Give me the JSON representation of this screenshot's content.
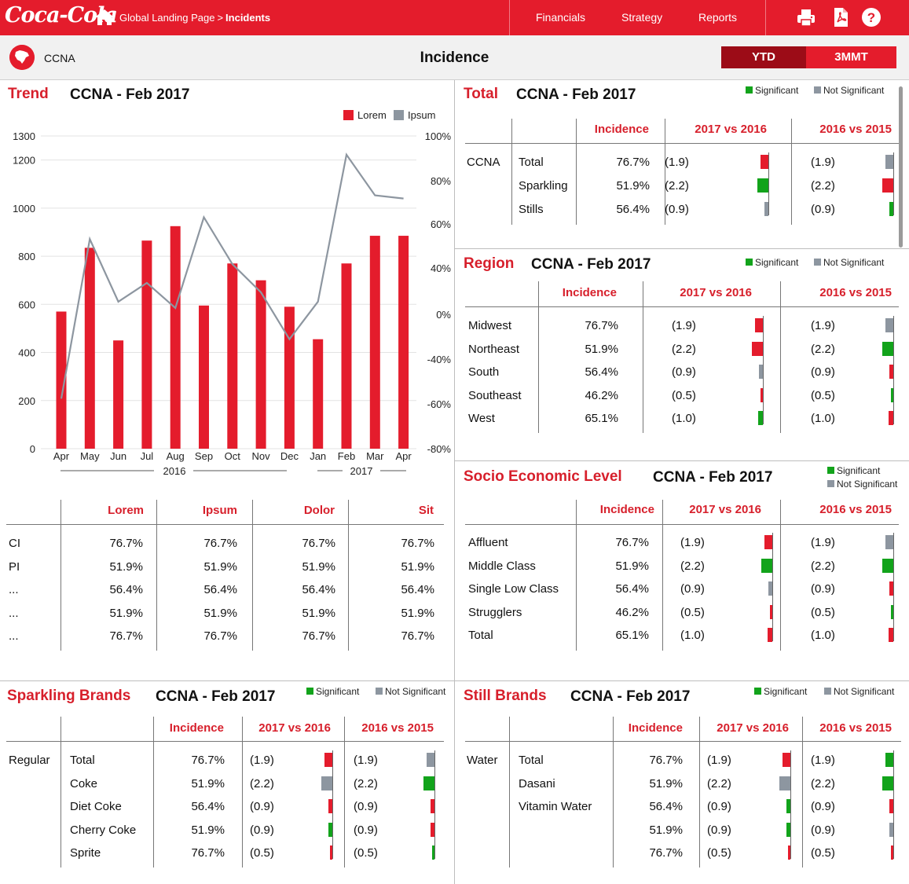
{
  "brand": {
    "logo_text": "Coca-Cola",
    "red": "#e41c2c",
    "dark_red": "#9c0c17",
    "green": "#12a31b",
    "grey": "#8d96a0"
  },
  "header": {
    "breadcrumb_home": "Global Landing Page",
    "breadcrumb_sep": ">",
    "breadcrumb_current": "Incidents",
    "nav": [
      "Financials",
      "Strategy",
      "Reports"
    ],
    "icons": [
      "print-icon",
      "pdf-icon",
      "help-icon"
    ]
  },
  "subheader": {
    "region": "CCNA",
    "title": "Incidence",
    "toggle": [
      "YTD",
      "3MMT"
    ],
    "toggle_active": "YTD"
  },
  "legend": {
    "significant": "Significant",
    "not_significant": "Not Significant"
  },
  "trend": {
    "title": "Trend",
    "subtitle": "CCNA - Feb 2017",
    "chart_data": {
      "type": "bar",
      "categories": [
        "Apr",
        "May",
        "Jun",
        "Jul",
        "Aug",
        "Sep",
        "Oct",
        "Nov",
        "Dec",
        "Jan",
        "Feb",
        "Mar",
        "Apr"
      ],
      "series": [
        {
          "name": "Lorem",
          "type": "bar",
          "axis": "left",
          "color": "#e41c2c",
          "values": [
            570,
            835,
            450,
            865,
            925,
            595,
            770,
            700,
            590,
            455,
            770,
            885,
            885
          ]
        },
        {
          "name": "Ipsum",
          "type": "line",
          "axis": "right",
          "color": "#8d96a0",
          "values": [
            16,
            67,
            47,
            53,
            45,
            74,
            59,
            50,
            35,
            47,
            94,
            81,
            80
          ]
        }
      ],
      "ylim_left": [
        0,
        1300
      ],
      "yticks_left": [
        "1300",
        "1200",
        "1000",
        "800",
        "600",
        "400",
        "200",
        "0"
      ],
      "yticks_left_values": [
        1300,
        1200,
        1000,
        800,
        600,
        400,
        200,
        0
      ],
      "yticks_right": [
        "100%",
        "80%",
        "60%",
        "40%",
        "0%",
        "-40%",
        "-60%",
        "-80%"
      ],
      "year_groups": [
        "2016",
        "2017"
      ]
    },
    "table": {
      "headers": [
        "Lorem",
        "Ipsum",
        "Dolor",
        "Sit"
      ],
      "rows": [
        {
          "label": "CI",
          "values": [
            "76.7%",
            "76.7%",
            "76.7%",
            "76.7%"
          ]
        },
        {
          "label": "PI",
          "values": [
            "51.9%",
            "51.9%",
            "51.9%",
            "51.9%"
          ]
        },
        {
          "label": "...",
          "values": [
            "56.4%",
            "56.4%",
            "56.4%",
            "56.4%"
          ]
        },
        {
          "label": "...",
          "values": [
            "51.9%",
            "51.9%",
            "51.9%",
            "51.9%"
          ]
        },
        {
          "label": "...",
          "values": [
            "76.7%",
            "76.7%",
            "76.7%",
            "76.7%"
          ]
        }
      ]
    }
  },
  "total": {
    "title": "Total",
    "subtitle": "CCNA - Feb 2017",
    "headers": [
      "Incidence",
      "2017 vs 2016",
      "2016 vs 2015"
    ],
    "group": "CCNA",
    "rows": [
      {
        "label": "Total",
        "incidence": "76.7%",
        "v1": "(1.9)",
        "b1": {
          "c": "red",
          "w": 10
        },
        "v2": "(1.9)",
        "b2": {
          "c": "grey",
          "w": 10
        }
      },
      {
        "label": "Sparkling",
        "incidence": "51.9%",
        "v1": "(2.2)",
        "b1": {
          "c": "green",
          "w": 14
        },
        "v2": "(2.2)",
        "b2": {
          "c": "red",
          "w": 14
        }
      },
      {
        "label": "Stills",
        "incidence": "56.4%",
        "v1": "(0.9)",
        "b1": {
          "c": "grey",
          "w": 5
        },
        "v2": "(0.9)",
        "b2": {
          "c": "green",
          "w": 5
        }
      }
    ]
  },
  "region": {
    "title": "Region",
    "subtitle": "CCNA - Feb 2017",
    "headers": [
      "Incidence",
      "2017 vs 2016",
      "2016 vs 2015"
    ],
    "rows": [
      {
        "label": "Midwest",
        "incidence": "76.7%",
        "v1": "(1.9)",
        "b1": {
          "c": "red",
          "w": 10
        },
        "v2": "(1.9)",
        "b2": {
          "c": "grey",
          "w": 10
        }
      },
      {
        "label": "Northeast",
        "incidence": "51.9%",
        "v1": "(2.2)",
        "b1": {
          "c": "red",
          "w": 14
        },
        "v2": "(2.2)",
        "b2": {
          "c": "green",
          "w": 14
        }
      },
      {
        "label": "South",
        "incidence": "56.4%",
        "v1": "(0.9)",
        "b1": {
          "c": "grey",
          "w": 5
        },
        "v2": "(0.9)",
        "b2": {
          "c": "red",
          "w": 5
        }
      },
      {
        "label": "Southeast",
        "incidence": "46.2%",
        "v1": "(0.5)",
        "b1": {
          "c": "red",
          "w": 3
        },
        "v2": "(0.5)",
        "b2": {
          "c": "green",
          "w": 3
        }
      },
      {
        "label": "West",
        "incidence": "65.1%",
        "v1": "(1.0)",
        "b1": {
          "c": "green",
          "w": 6
        },
        "v2": "(1.0)",
        "b2": {
          "c": "red",
          "w": 6
        }
      }
    ]
  },
  "sel": {
    "title": "Socio Economic Level",
    "subtitle": "CCNA - Feb 2017",
    "headers": [
      "Incidence",
      "2017 vs 2016",
      "2016 vs 2015"
    ],
    "rows": [
      {
        "label": "Affluent",
        "incidence": "76.7%",
        "v1": "(1.9)",
        "b1": {
          "c": "red",
          "w": 10
        },
        "v2": "(1.9)",
        "b2": {
          "c": "grey",
          "w": 10
        }
      },
      {
        "label": "Middle Class",
        "incidence": "51.9%",
        "v1": "(2.2)",
        "b1": {
          "c": "green",
          "w": 14
        },
        "v2": "(2.2)",
        "b2": {
          "c": "green",
          "w": 14
        }
      },
      {
        "label": "Single Low Class",
        "incidence": "56.4%",
        "v1": "(0.9)",
        "b1": {
          "c": "grey",
          "w": 5
        },
        "v2": "(0.9)",
        "b2": {
          "c": "red",
          "w": 5
        }
      },
      {
        "label": "Strugglers",
        "incidence": "46.2%",
        "v1": "(0.5)",
        "b1": {
          "c": "red",
          "w": 3
        },
        "v2": "(0.5)",
        "b2": {
          "c": "green",
          "w": 3
        }
      },
      {
        "label": "Total",
        "incidence": "65.1%",
        "v1": "(1.0)",
        "b1": {
          "c": "red",
          "w": 6
        },
        "v2": "(1.0)",
        "b2": {
          "c": "red",
          "w": 6
        }
      }
    ]
  },
  "sparkling": {
    "title": "Sparkling Brands",
    "subtitle": "CCNA - Feb 2017",
    "headers": [
      "Incidence",
      "2017 vs 2016",
      "2016 vs 2015"
    ],
    "group": "Regular",
    "rows": [
      {
        "label": "Total",
        "incidence": "76.7%",
        "v1": "(1.9)",
        "b1": {
          "c": "red",
          "w": 10
        },
        "v2": "(1.9)",
        "b2": {
          "c": "grey",
          "w": 10
        }
      },
      {
        "label": "Coke",
        "incidence": "51.9%",
        "v1": "(2.2)",
        "b1": {
          "c": "grey",
          "w": 14
        },
        "v2": "(2.2)",
        "b2": {
          "c": "green",
          "w": 14
        }
      },
      {
        "label": "Diet Coke",
        "incidence": "56.4%",
        "v1": "(0.9)",
        "b1": {
          "c": "red",
          "w": 5
        },
        "v2": "(0.9)",
        "b2": {
          "c": "red",
          "w": 5
        }
      },
      {
        "label": "Cherry Coke",
        "incidence": "51.9%",
        "v1": "(0.9)",
        "b1": {
          "c": "green",
          "w": 5
        },
        "v2": "(0.9)",
        "b2": {
          "c": "red",
          "w": 5
        }
      },
      {
        "label": "Sprite",
        "incidence": "76.7%",
        "v1": "(0.5)",
        "b1": {
          "c": "red",
          "w": 3
        },
        "v2": "(0.5)",
        "b2": {
          "c": "green",
          "w": 3
        }
      }
    ]
  },
  "still": {
    "title": "Still Brands",
    "subtitle": "CCNA - Feb 2017",
    "headers": [
      "Incidence",
      "2017 vs 2016",
      "2016 vs 2015"
    ],
    "group": "Water",
    "rows": [
      {
        "label": "Total",
        "incidence": "76.7%",
        "v1": "(1.9)",
        "b1": {
          "c": "red",
          "w": 10
        },
        "v2": "(1.9)",
        "b2": {
          "c": "green",
          "w": 10
        }
      },
      {
        "label": "Dasani",
        "incidence": "51.9%",
        "v1": "(2.2)",
        "b1": {
          "c": "grey",
          "w": 14
        },
        "v2": "(2.2)",
        "b2": {
          "c": "green",
          "w": 14
        }
      },
      {
        "label": "Vitamin Water",
        "incidence": "56.4%",
        "v1": "(0.9)",
        "b1": {
          "c": "green",
          "w": 5
        },
        "v2": "(0.9)",
        "b2": {
          "c": "red",
          "w": 5
        }
      },
      {
        "label": "",
        "incidence": "51.9%",
        "v1": "(0.9)",
        "b1": {
          "c": "green",
          "w": 5
        },
        "v2": "(0.9)",
        "b2": {
          "c": "grey",
          "w": 5
        }
      },
      {
        "label": "",
        "incidence": "76.7%",
        "v1": "(0.5)",
        "b1": {
          "c": "red",
          "w": 3
        },
        "v2": "(0.5)",
        "b2": {
          "c": "red",
          "w": 3
        }
      }
    ]
  }
}
